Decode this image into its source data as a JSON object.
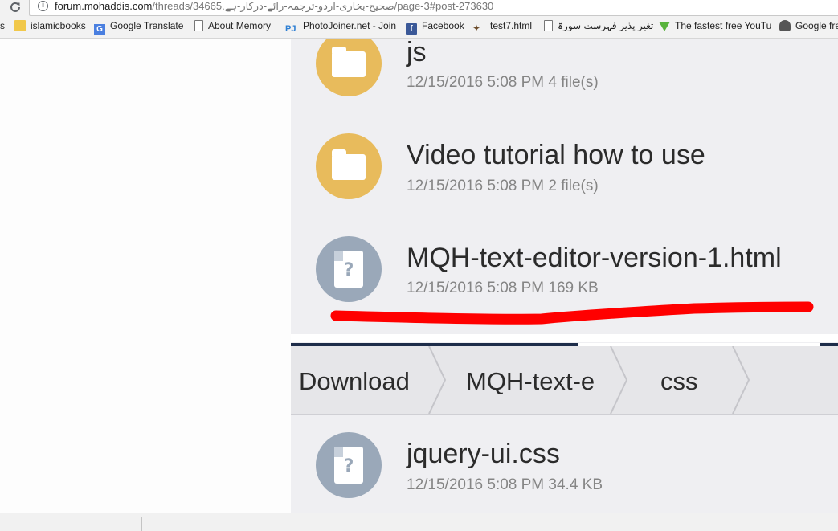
{
  "browser": {
    "url_host": "forum.mohaddis.com",
    "url_path": "/threads/34665.صحیح-بخاری-اردو-ترجمہ-رائے-درکار-ہے/page-3#post-273630"
  },
  "bookmarks": [
    {
      "label": "s",
      "icon": "none"
    },
    {
      "label": "islamicbooks",
      "icon": "folder-icon"
    },
    {
      "label": "Google Translate",
      "icon": "google-translate-icon"
    },
    {
      "label": "About Memory",
      "icon": "page-icon"
    },
    {
      "label": "PhotoJoiner.net - Join",
      "icon": "photojoiner-icon"
    },
    {
      "label": "Facebook",
      "icon": "facebook-icon"
    },
    {
      "label": "test7.html",
      "icon": "moose-icon"
    },
    {
      "label": "تغیر پذیر فہرست سورۃ",
      "icon": "page-icon"
    },
    {
      "label": "The fastest free YouTu",
      "icon": "download-arrow-icon"
    },
    {
      "label": "Google fre",
      "icon": "profile-icon"
    }
  ],
  "files_top": [
    {
      "name": "js",
      "meta": "12/15/2016 5:08 PM  4 file(s)",
      "type": "folder"
    },
    {
      "name": "Video tutorial how to use",
      "meta": "12/15/2016 5:08 PM  2 file(s)",
      "type": "folder"
    },
    {
      "name": "MQH-text-editor-version-1.html",
      "meta": "12/15/2016 5:08 PM  169 KB",
      "type": "file"
    }
  ],
  "breadcrumb": [
    "Download",
    "MQH-text-e",
    "css"
  ],
  "files_bottom": [
    {
      "name": "jquery-ui.css",
      "meta": "12/15/2016 5:08 PM  34.4 KB",
      "type": "file"
    }
  ],
  "colors": {
    "folder": "#e8bb5c",
    "file": "#9aa8b9",
    "underline": "#ff0000",
    "tab_dark": "#1e2d4a"
  }
}
